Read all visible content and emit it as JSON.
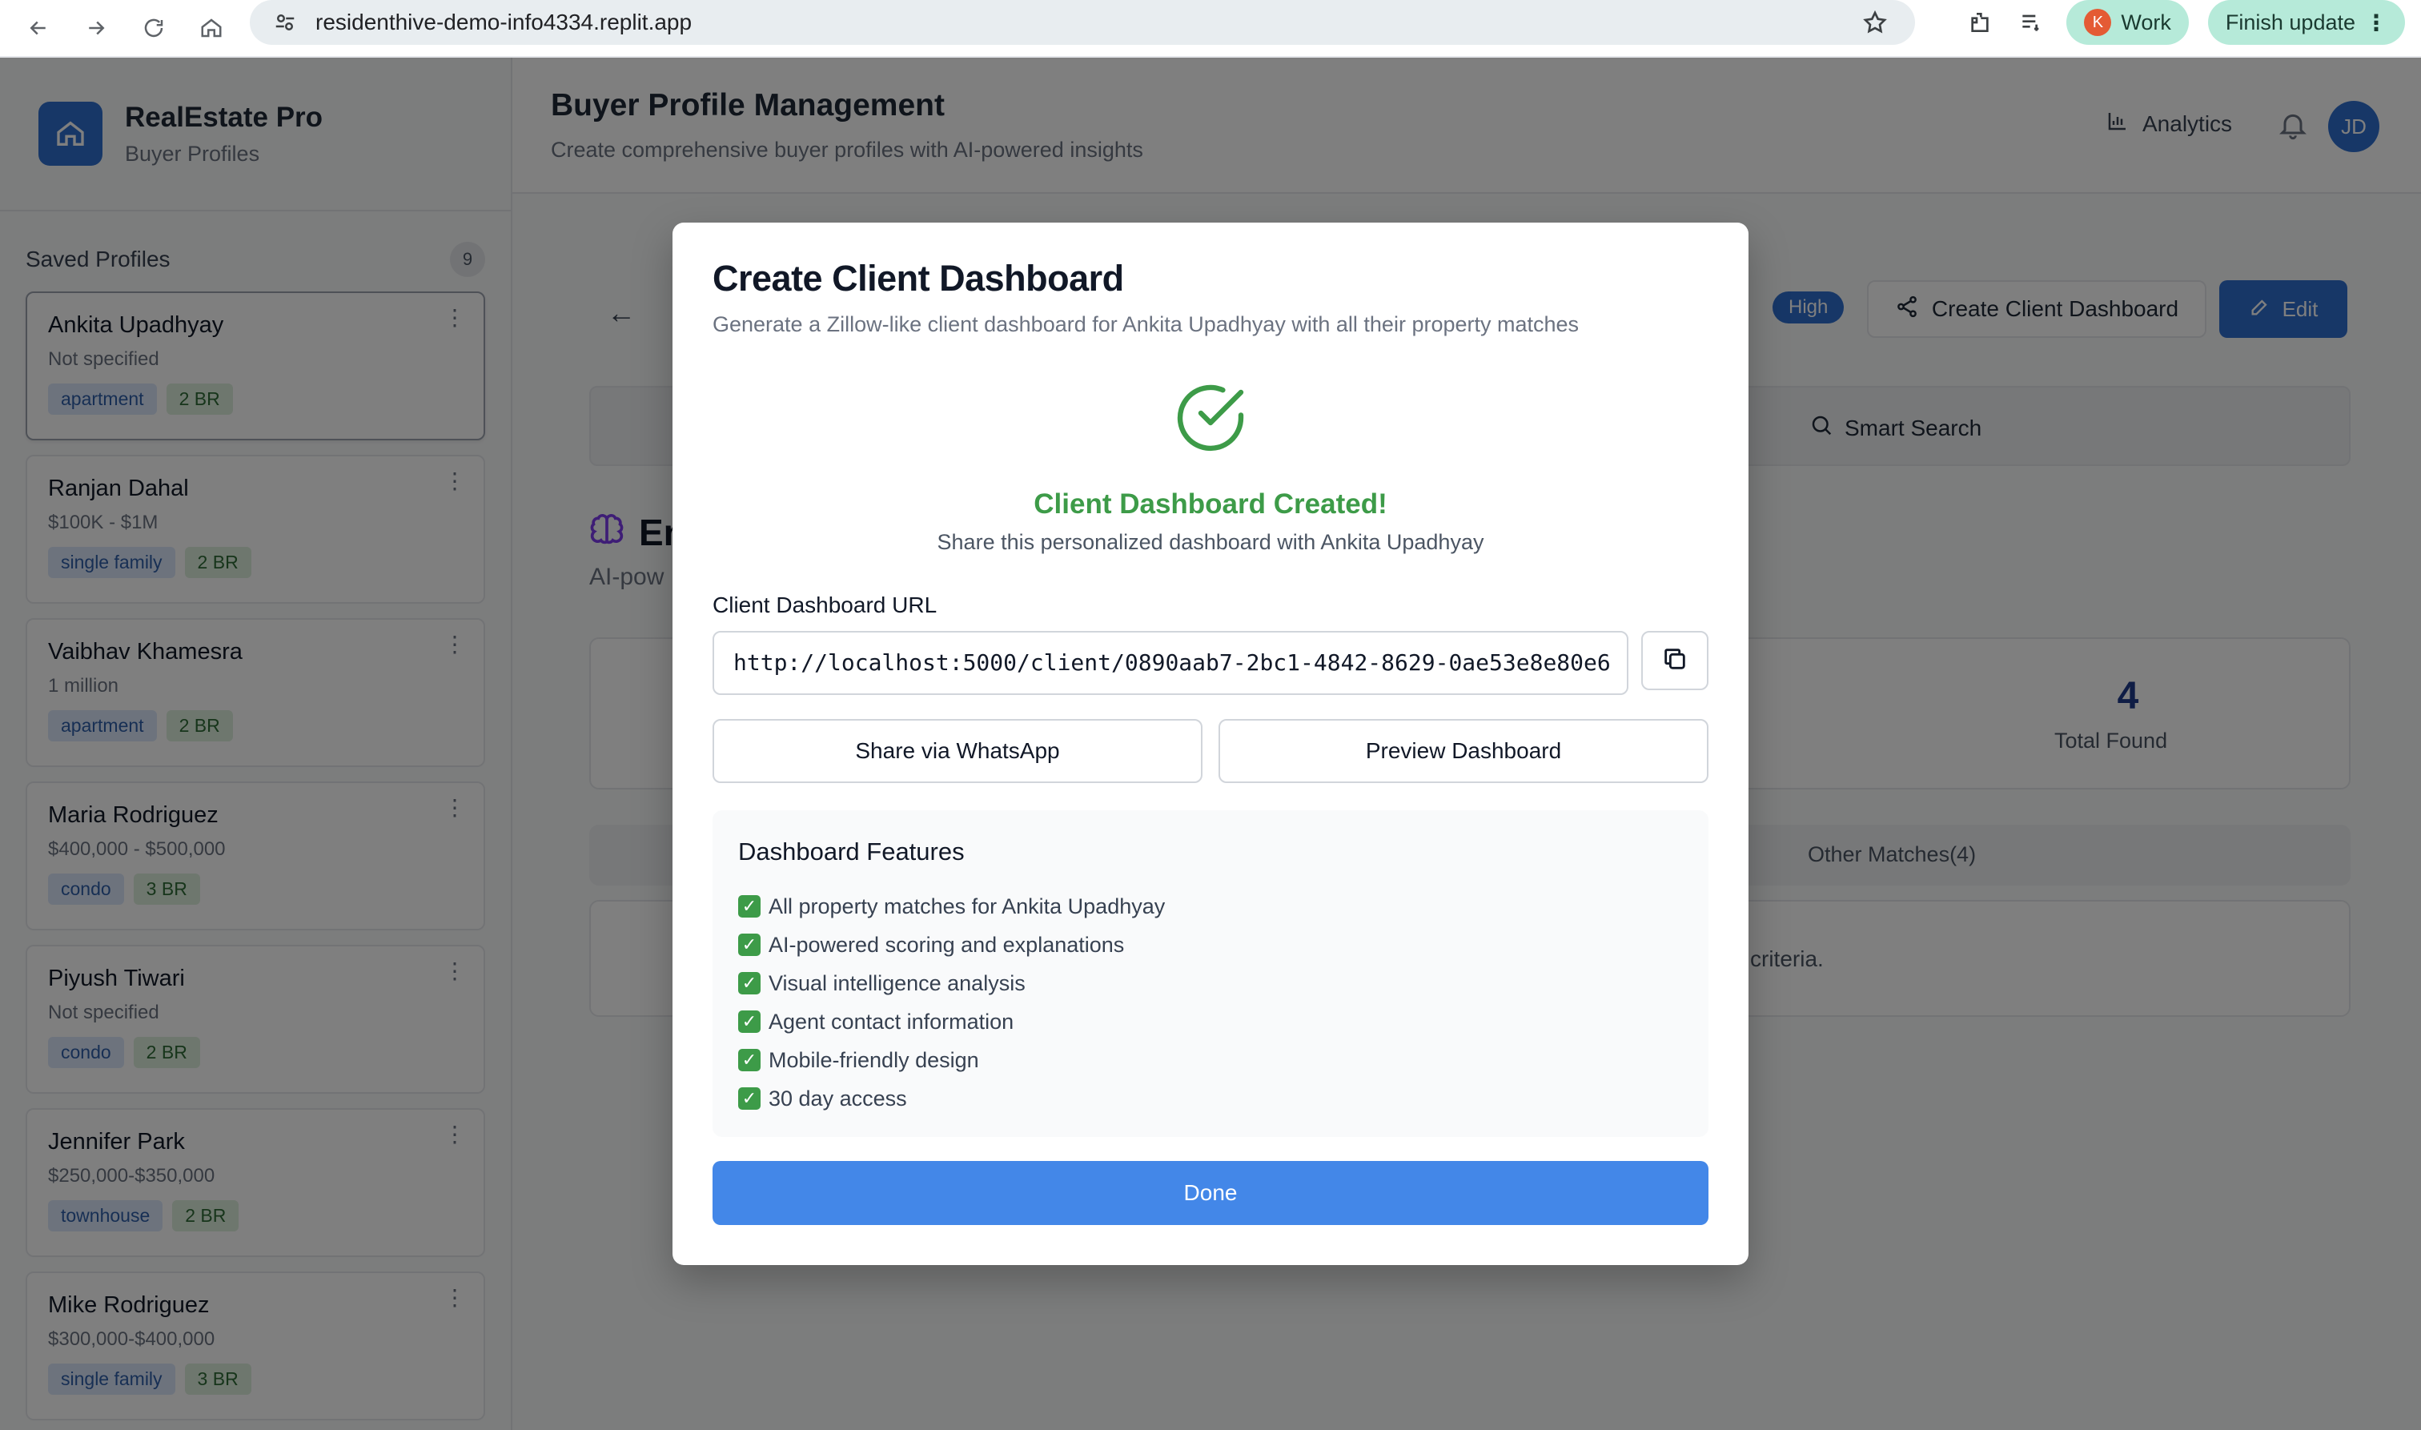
{
  "browser": {
    "url": "residenthive-demo-info4334.replit.app",
    "profile_initial": "K",
    "profile_label": "Work",
    "update_label": "Finish update"
  },
  "sidebar": {
    "brand_name": "RealEstate Pro",
    "brand_sub": "Buyer Profiles",
    "saved_title": "Saved Profiles",
    "saved_count": "9",
    "profiles": [
      {
        "name": "Ankita Upadhyay",
        "budget": "Not specified",
        "type": "apartment",
        "beds": "2 BR"
      },
      {
        "name": "Ranjan Dahal",
        "budget": "$100K - $1M",
        "type": "single family",
        "beds": "2 BR"
      },
      {
        "name": "Vaibhav Khamesra",
        "budget": "1 million",
        "type": "apartment",
        "beds": "2 BR"
      },
      {
        "name": "Maria Rodriguez",
        "budget": "$400,000 - $500,000",
        "type": "condo",
        "beds": "3 BR"
      },
      {
        "name": "Piyush Tiwari",
        "budget": "Not specified",
        "type": "condo",
        "beds": "2 BR"
      },
      {
        "name": "Jennifer Park",
        "budget": "$250,000-$350,000",
        "type": "townhouse",
        "beds": "2 BR"
      },
      {
        "name": "Mike Rodriguez",
        "budget": "$300,000-$400,000",
        "type": "single family",
        "beds": "3 BR"
      }
    ]
  },
  "header": {
    "title": "Buyer Profile Management",
    "subtitle": "Create comprehensive buyer profiles with AI-powered insights",
    "analytics_label": "Analytics",
    "user_initials": "JD"
  },
  "background": {
    "high_badge": "High",
    "create_dashboard_label": "Create Client Dashboard",
    "edit_label": "Edit",
    "smart_search_label": "Smart Search",
    "section_title_fragment": "En",
    "section_sub_fragment": "AI-pow",
    "total_found_value": "4",
    "total_found_label": "Total Found",
    "other_matches_label": "Other Matches(4)",
    "criteria_fragment": "criteria."
  },
  "modal": {
    "title": "Create Client Dashboard",
    "subtitle": "Generate a Zillow-like client dashboard for Ankita Upadhyay with all their property matches",
    "created_title": "Client Dashboard Created!",
    "created_sub": "Share this personalized dashboard with Ankita Upadhyay",
    "url_label": "Client Dashboard URL",
    "url_value": "http://localhost:5000/client/0890aab7-2bc1-4842-8629-0ae53e8e80e6",
    "whatsapp_label": "Share via WhatsApp",
    "preview_label": "Preview Dashboard",
    "features_title": "Dashboard Features",
    "features": [
      "All property matches for Ankita Upadhyay",
      "AI-powered scoring and explanations",
      "Visual intelligence analysis",
      "Agent contact information",
      "Mobile-friendly design",
      "30 day access"
    ],
    "done_label": "Done"
  },
  "colors": {
    "primary": "#2f6fcf",
    "success": "#3d9b48",
    "done_button": "#4387e8"
  }
}
